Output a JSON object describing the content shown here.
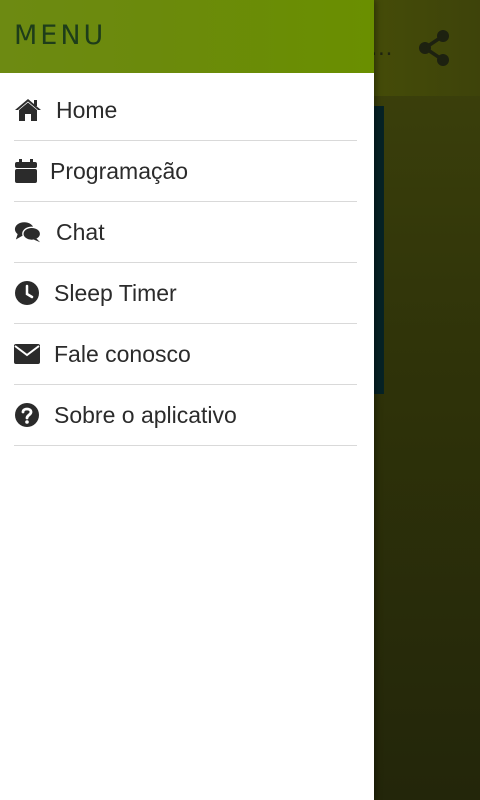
{
  "background_app": {
    "title_fragment": "o…",
    "share_icon": "share-icon"
  },
  "drawer": {
    "title": "MENU",
    "items": [
      {
        "label": "Home",
        "icon": "home-icon"
      },
      {
        "label": "Programação",
        "icon": "calendar-icon"
      },
      {
        "label": "Chat",
        "icon": "chat-icon"
      },
      {
        "label": "Sleep Timer",
        "icon": "clock-icon"
      },
      {
        "label": "Fale conosco",
        "icon": "envelope-icon"
      },
      {
        "label": "Sobre o aplicativo",
        "icon": "question-circle-icon"
      }
    ]
  },
  "colors": {
    "drawer_header": "#6b8a0c",
    "menu_title": "#1e3d1a",
    "menu_text": "#2b2b2b",
    "divider": "#d9d9d9"
  }
}
